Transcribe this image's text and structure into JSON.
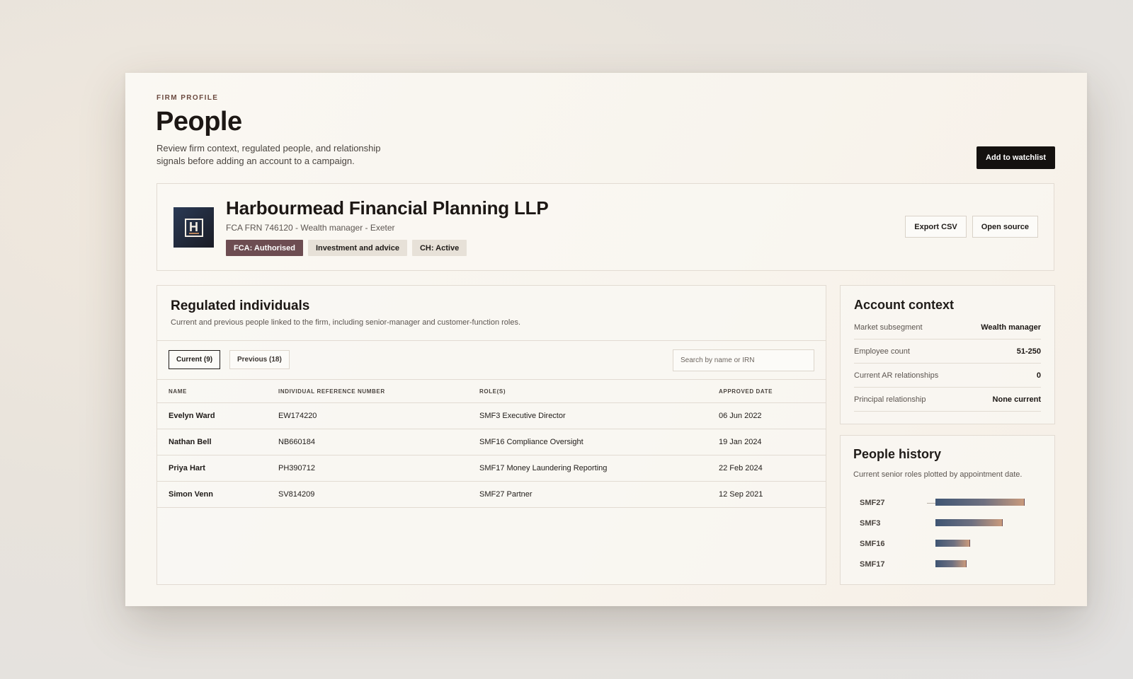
{
  "page": {
    "eyebrow": "FIRM PROFILE",
    "title": "People",
    "description": "Review firm context, regulated people, and relationship signals before adding an account to a campaign.",
    "watchlist_label": "Add to watchlist"
  },
  "firm": {
    "logo_letter": "H",
    "name": "Harbourmead Financial Planning LLP",
    "meta": "FCA FRN 746120 - Wealth manager - Exeter",
    "tags": [
      "FCA: Authorised",
      "Investment and advice",
      "CH: Active"
    ],
    "export_label": "Export CSV",
    "source_label": "Open source"
  },
  "people": {
    "title": "Regulated individuals",
    "subtitle": "Current and previous people linked to the firm, including senior-manager and customer-function roles.",
    "tabs": [
      "Current (9)",
      "Previous (18)"
    ],
    "search_placeholder": "Search by name or IRN",
    "columns": [
      "NAME",
      "INDIVIDUAL REFERENCE NUMBER",
      "ROLE(S)",
      "APPROVED DATE"
    ],
    "rows": [
      {
        "name": "Evelyn Ward",
        "irn": "EW174220",
        "role": "SMF3 Executive Director",
        "date": "06 Jun 2022"
      },
      {
        "name": "Nathan Bell",
        "irn": "NB660184",
        "role": "SMF16 Compliance Oversight",
        "date": "19 Jan 2024"
      },
      {
        "name": "Priya Hart",
        "irn": "PH390712",
        "role": "SMF17 Money Laundering Reporting",
        "date": "22 Feb 2024"
      },
      {
        "name": "Simon Venn",
        "irn": "SV814209",
        "role": "SMF27 Partner",
        "date": "12 Sep 2021"
      }
    ]
  },
  "context": {
    "title": "Account context",
    "rows": [
      {
        "label": "Market subsegment",
        "value": "Wealth manager"
      },
      {
        "label": "Employee count",
        "value": "51-250"
      },
      {
        "label": "Current AR relationships",
        "value": "0"
      },
      {
        "label": "Principal relationship",
        "value": "None current"
      }
    ]
  },
  "history": {
    "title": "People history",
    "subtitle": "Current senior roles plotted by appointment date."
  },
  "chart_data": {
    "type": "bar",
    "orientation": "horizontal",
    "categories": [
      "SMF27",
      "SMF3",
      "SMF16",
      "SMF17"
    ],
    "values": [
      0.78,
      0.59,
      0.3,
      0.27
    ],
    "value_unit": "fraction of plot width (relative tenure, approximate)"
  }
}
